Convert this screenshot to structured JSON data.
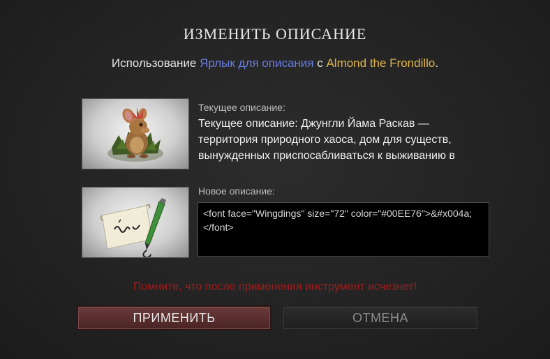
{
  "dialog": {
    "title": "ИЗМЕНИТЬ ОПИСАНИЕ",
    "usage": {
      "prefix": "Использование ",
      "tool_name": "Ярлык для описания",
      "middle": " с ",
      "hero_name": "Almond the Frondillo",
      "suffix": "."
    },
    "current": {
      "label": "Текущее описание:",
      "text": "Текущее описание: Джунгли Йама Раскав — территория природного хаоса, дом для существ, вынужденных приспосабливаться к выживанию в"
    },
    "new": {
      "label": "Новое описание:",
      "value": "<font face=\"Wingdings\" size=\"72\" color=\"#00EE76\">&#x004a;</font>"
    },
    "warning": "Помните, что после применения инструмент исчезнет!",
    "buttons": {
      "apply": "ПРИМЕНИТЬ",
      "cancel": "ОТМЕНА"
    }
  },
  "colors": {
    "tool_name": "#6a7de0",
    "hero_name": "#e0b64a",
    "warning": "#9b1f1f"
  },
  "icons": {
    "creature": "almond-the-frondillo-icon",
    "tool": "description-tag-scroll-brush-icon"
  }
}
